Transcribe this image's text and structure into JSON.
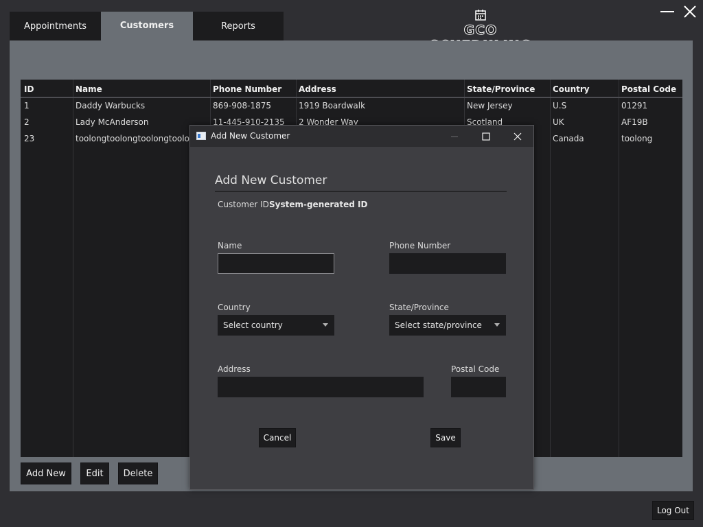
{
  "tabs": [
    {
      "label": "Appointments",
      "active": false
    },
    {
      "label": "Customers",
      "active": true
    },
    {
      "label": "Reports",
      "active": false
    }
  ],
  "app": {
    "logo_text": "GCO SCHEDULING",
    "logo_icon": "calendar-icon"
  },
  "window_controls": {
    "minimize_icon": "minimize-icon",
    "close_icon": "close-icon"
  },
  "table": {
    "columns": [
      "ID",
      "Name",
      "Phone Number",
      "Address",
      "State/Province",
      "Country",
      "Postal Code"
    ],
    "rows": [
      [
        "1",
        "Daddy Warbucks",
        "869-908-1875",
        "1919 Boardwalk",
        "New Jersey",
        "U.S",
        "01291"
      ],
      [
        "2",
        "Lady McAnderson",
        "11-445-910-2135",
        "2 Wonder Way",
        "Scotland",
        "UK",
        "AF19B"
      ],
      [
        "23",
        "toolongtoolongtoolongtoolong",
        "",
        "",
        "",
        "Canada",
        "toolong"
      ]
    ]
  },
  "actions": {
    "add": "Add New",
    "edit": "Edit",
    "delete": "Delete",
    "logout": "Log Out"
  },
  "dialog": {
    "window_title": "Add New Customer",
    "heading": "Add New Customer",
    "customer_id_label": "Customer ID:",
    "customer_id_value": "System-generated ID",
    "name_label": "Name",
    "name_value": "",
    "phone_label": "Phone Number",
    "phone_value": "",
    "country_label": "Country",
    "country_selected": "Select country",
    "state_label": "State/Province",
    "state_selected": "Select state/province",
    "address_label": "Address",
    "address_value": "",
    "postal_label": "Postal Code",
    "postal_value": "",
    "cancel": "Cancel",
    "save": "Save"
  },
  "colors": {
    "background": "#2f2f33",
    "panel": "#6a6f75",
    "grid": "#1c1c1e",
    "dialog": "#3e3e42"
  }
}
